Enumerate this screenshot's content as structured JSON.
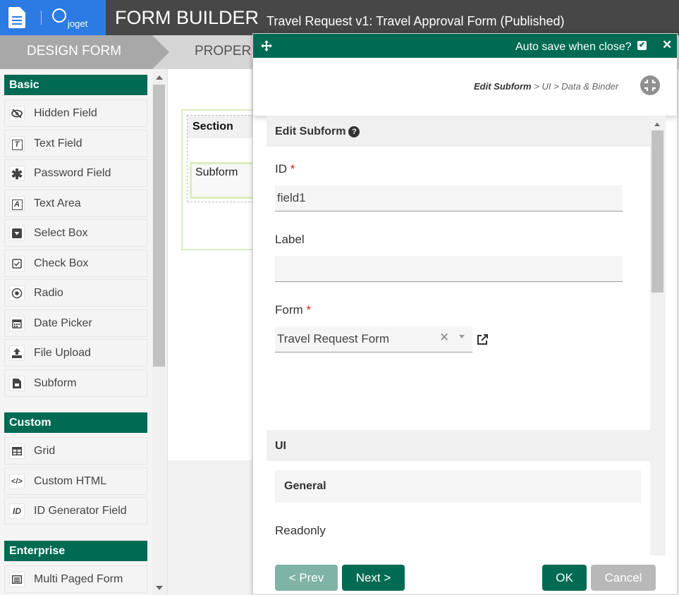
{
  "header": {
    "logo_text": "joget",
    "title": "FORM BUILDER",
    "subtitle": "Travel Request v1: Travel Approval Form (Published)"
  },
  "tabs": {
    "design": "DESIGN FORM",
    "properties": "PROPER"
  },
  "sidebar": {
    "categories": [
      {
        "name": "Basic",
        "items": [
          {
            "label": "Hidden Field",
            "icon": "eye-slash-icon"
          },
          {
            "label": "Text Field",
            "icon": "text-field-icon"
          },
          {
            "label": "Password Field",
            "icon": "asterisk-icon"
          },
          {
            "label": "Text Area",
            "icon": "text-area-icon"
          },
          {
            "label": "Select Box",
            "icon": "select-box-icon"
          },
          {
            "label": "Check Box",
            "icon": "checkbox-icon"
          },
          {
            "label": "Radio",
            "icon": "radio-icon"
          },
          {
            "label": "Date Picker",
            "icon": "calendar-icon"
          },
          {
            "label": "File Upload",
            "icon": "upload-icon"
          },
          {
            "label": "Subform",
            "icon": "subform-icon"
          }
        ]
      },
      {
        "name": "Custom",
        "items": [
          {
            "label": "Grid",
            "icon": "grid-icon"
          },
          {
            "label": "Custom HTML",
            "icon": "code-icon"
          },
          {
            "label": "ID Generator Field",
            "icon": "id-icon"
          }
        ]
      },
      {
        "name": "Enterprise",
        "items": [
          {
            "label": "Multi Paged Form",
            "icon": "multi-page-icon"
          }
        ]
      }
    ]
  },
  "canvas": {
    "section_label": "Section",
    "subform_label": "Subform"
  },
  "dialog": {
    "autosave_label": "Auto save when close?",
    "breadcrumb": {
      "current": "Edit Subform",
      "sep": ">",
      "step2": "UI",
      "step3": "Data & Binder"
    },
    "edit_title": "Edit Subform",
    "fields": {
      "id_label": "ID",
      "id_value": "field1",
      "label_label": "Label",
      "label_value": "",
      "form_label": "Form",
      "form_value": "Travel Request Form",
      "required_mark": "*"
    },
    "ui_section": "UI",
    "general_section": "General",
    "readonly_label": "Readonly",
    "readonly_checked": true,
    "buttons": {
      "prev": "< Prev",
      "next": "Next >",
      "ok": "OK",
      "cancel": "Cancel"
    }
  },
  "colors": {
    "accent": "#006b52",
    "header_bg": "#474747",
    "logo_bg": "#2c7be5",
    "prev_disabled": "#7fb3a8",
    "cancel_disabled": "#b8b8b8"
  }
}
